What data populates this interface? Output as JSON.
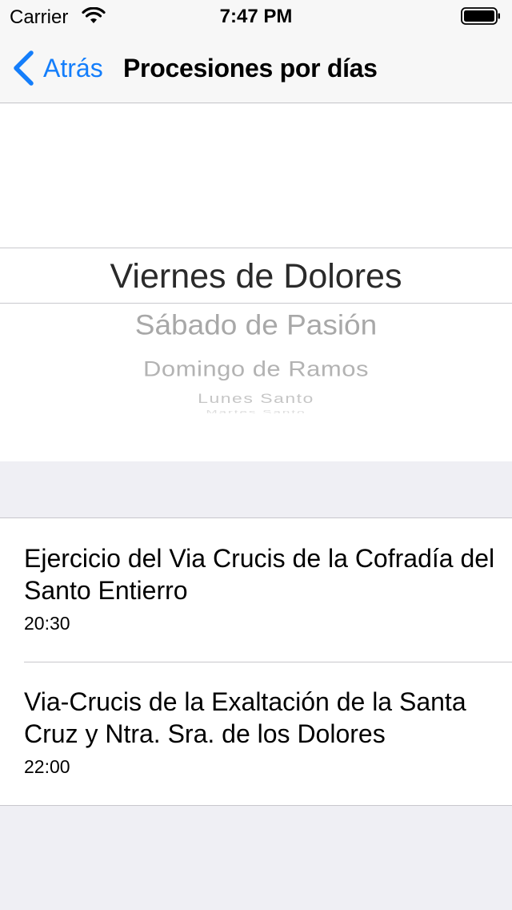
{
  "status_bar": {
    "carrier": "Carrier",
    "time": "7:47 PM"
  },
  "nav": {
    "back_label": "Atrás",
    "title": "Procesiones por días"
  },
  "picker": {
    "selected": "Viernes de Dolores",
    "options_below": [
      "Sábado de Pasión",
      "Domingo de Ramos",
      "Lunes Santo",
      "Martes Santo"
    ]
  },
  "processions": [
    {
      "title": "Ejercicio del Via Crucis de la Cofradía del Santo Entierro",
      "time": "20:30"
    },
    {
      "title": "Via-Crucis de la Exaltación de la Santa Cruz y Ntra. Sra. de los Dolores",
      "time": "22:00"
    }
  ],
  "colors": {
    "accent": "#147efb",
    "bar_background": "#f7f7f7",
    "page_background": "#efeff4"
  },
  "icons": {
    "back": "chevron-left-icon",
    "wifi": "wifi-icon",
    "battery": "battery-icon"
  }
}
